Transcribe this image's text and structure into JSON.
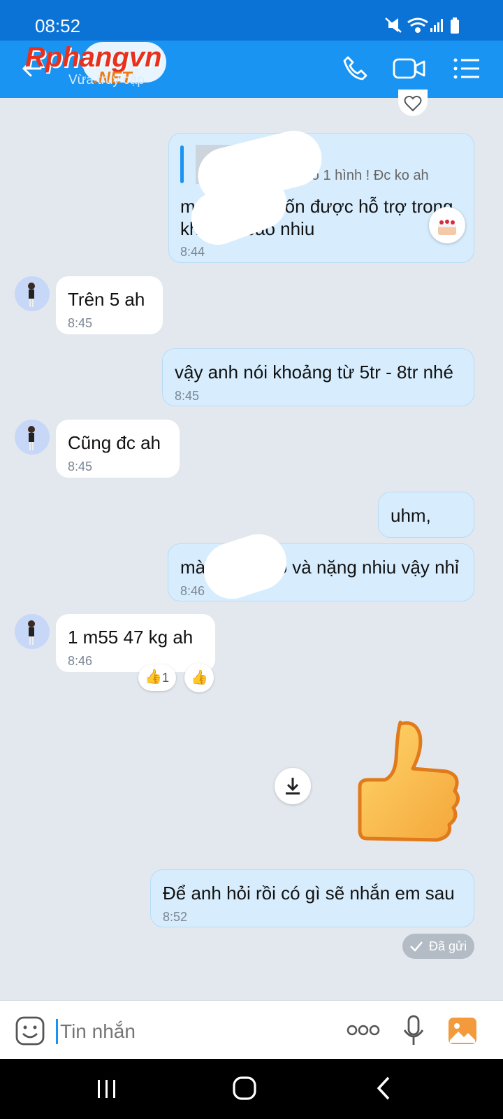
{
  "status": {
    "time": "08:52"
  },
  "header": {
    "subtitle": "Vừa truy cập",
    "watermark_top": "Rphangvn",
    "watermark_bottom": ".NET"
  },
  "messages": {
    "m1": {
      "quote": "nh] Có 1 hình ! Đc ko ah",
      "text_line1": "m",
      "text_line1b": "ốn được hỗ trợ trong",
      "text_line2": "khoảng bao nhiu",
      "time": "8:44"
    },
    "m2": {
      "text": "Trên 5 ah",
      "time": "8:45"
    },
    "m3": {
      "text": "vậy anh nói khoảng từ 5tr - 8tr nhé",
      "time": "8:45"
    },
    "m4": {
      "text": "Cũng đc ah",
      "time": "8:45"
    },
    "m5": {
      "text": "uhm,"
    },
    "m6": {
      "text_a": "mà",
      "text_b": "no và nặng nhiu vậy nhỉ",
      "time": "8:46"
    },
    "m7": {
      "text": "1 m55 47 kg ah",
      "time": "8:46",
      "reaction_count": "1"
    },
    "m8": {
      "text": "Để anh hỏi rồi có gì sẽ nhắn em sau",
      "time": "8:52"
    },
    "sent_status": "Đã gửi"
  },
  "input": {
    "placeholder": "Tin nhắn"
  },
  "colors": {
    "header": "#1a94f2",
    "statusbar": "#0b73d6",
    "outgoing": "#d7edfd",
    "chat_bg": "#e3e8ef"
  }
}
